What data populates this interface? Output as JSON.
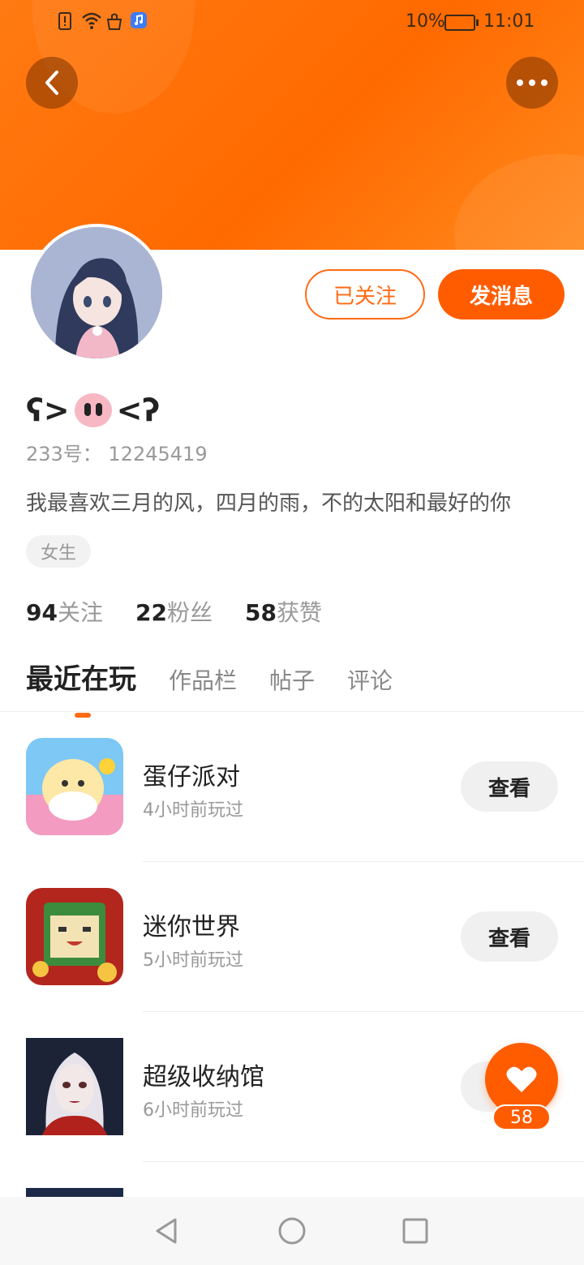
{
  "status_bar": {
    "battery": "10%",
    "time": "11:01"
  },
  "icons": {
    "back": "chevron-left-icon",
    "more": "more-dots-icon",
    "like": "heart-icon"
  },
  "colors": {
    "accent": "#ff5c00",
    "banner": "#ff7a12"
  },
  "profile": {
    "nickname_left": "ʕ>",
    "nickname_right": "<ʔ",
    "user_id": "233号：  12245419",
    "bio": "我最喜欢三月的风，四月的雨，不的太阳和最好的你",
    "gender": "女生"
  },
  "actions": {
    "follow_label": "已关注",
    "message_label": "发消息"
  },
  "stats": [
    {
      "value": "94",
      "label": "关注"
    },
    {
      "value": "22",
      "label": "粉丝"
    },
    {
      "value": "58",
      "label": "获赞"
    }
  ],
  "tabs": [
    {
      "label": "最近在玩",
      "active": true
    },
    {
      "label": "作品栏",
      "active": false
    },
    {
      "label": "帖子",
      "active": false
    },
    {
      "label": "评论",
      "active": false
    }
  ],
  "games": [
    {
      "name": "蛋仔派对",
      "time": "4小时前玩过",
      "button": "查看"
    },
    {
      "name": "迷你世界",
      "time": "5小时前玩过",
      "button": "查看"
    },
    {
      "name": "超级收纳馆",
      "time": "6小时前玩过",
      "button": "查看"
    }
  ],
  "like_fab": {
    "count": "58"
  }
}
